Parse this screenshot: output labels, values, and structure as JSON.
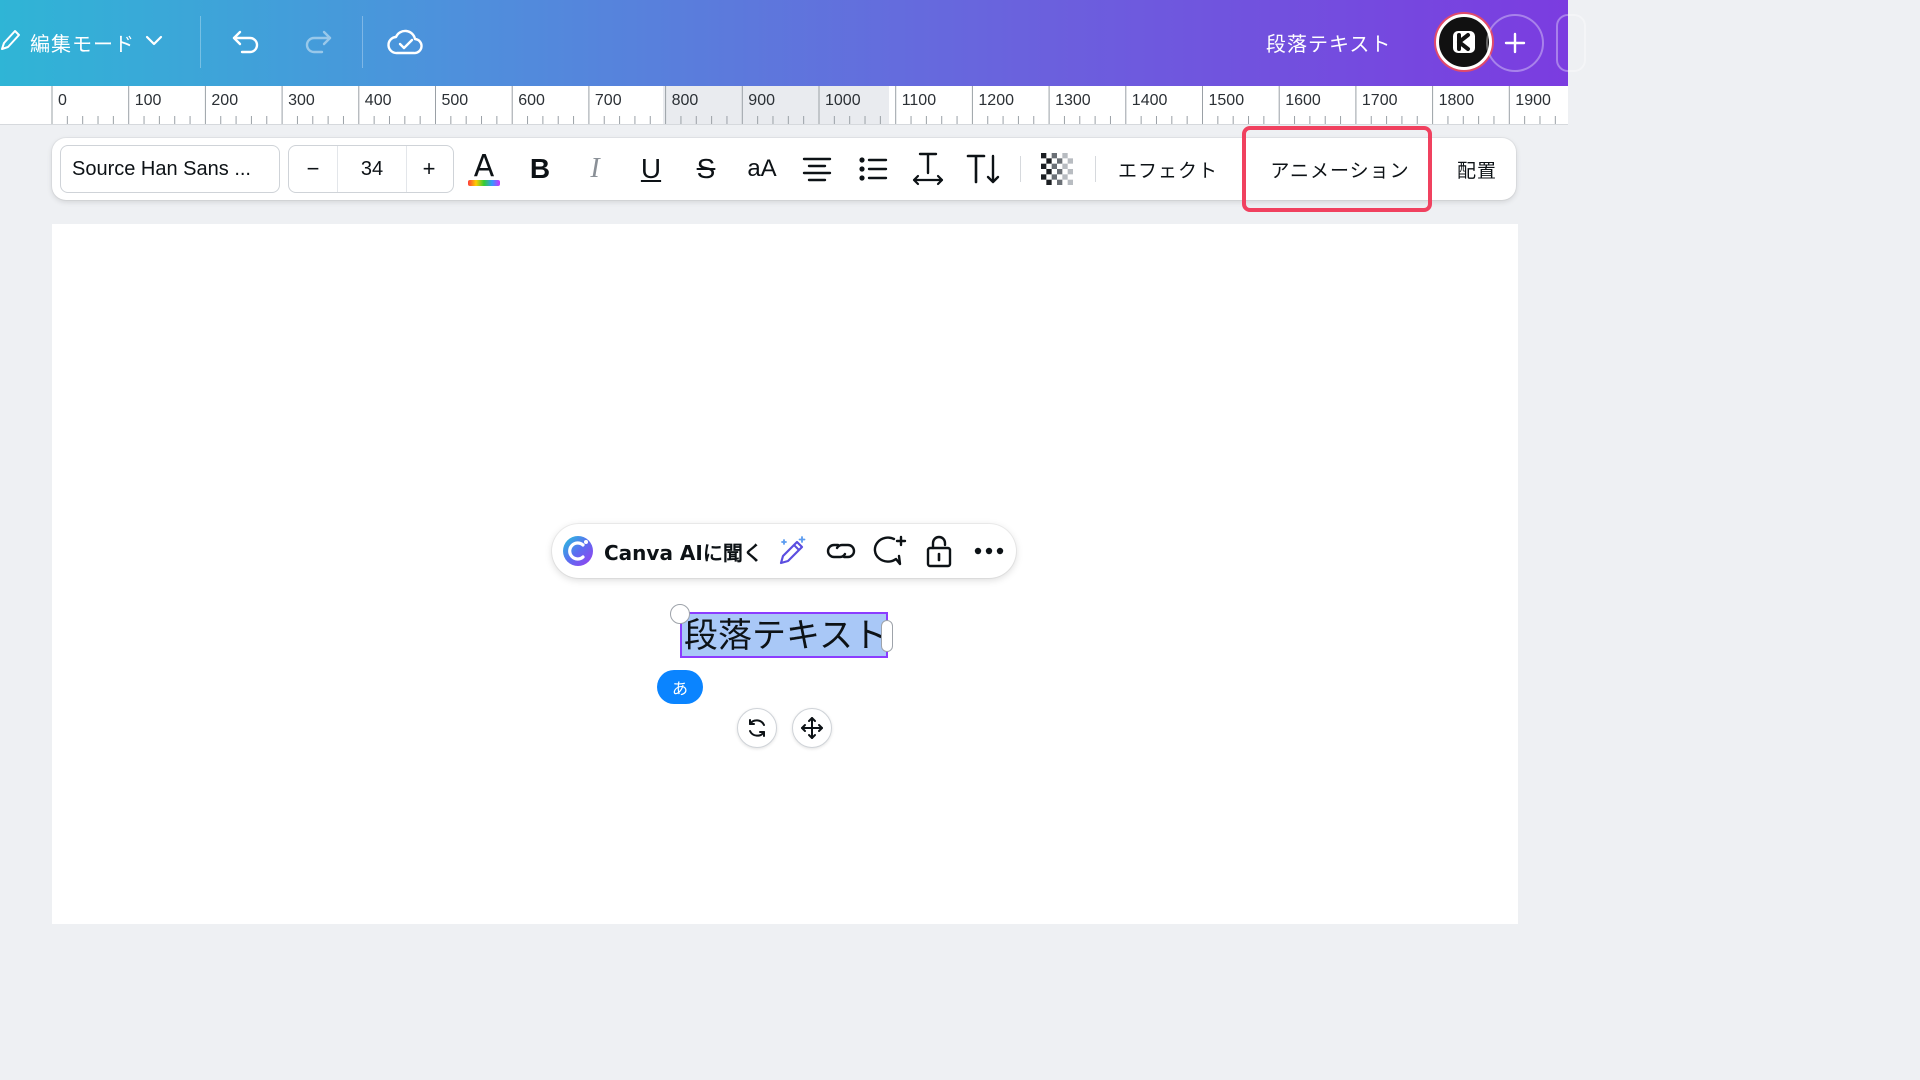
{
  "header": {
    "edit_mode_label": "編集モード",
    "doc_title": "段落テキスト"
  },
  "ruler": {
    "labels": [
      "0",
      "100",
      "200",
      "300",
      "400",
      "500",
      "600",
      "700",
      "800",
      "900",
      "1000",
      "1100",
      "1200",
      "1300",
      "1400",
      "1500",
      "1600",
      "1700",
      "1800",
      "1900"
    ],
    "highlight_range": [
      800,
      1000
    ]
  },
  "toolbar": {
    "font_name": "Source Han Sans ...",
    "font_size": "34",
    "minus_label": "−",
    "plus_label": "+",
    "text_color_glyph": "A",
    "bold_glyph": "B",
    "italic_glyph": "I",
    "underline_glyph": "U",
    "strike_glyph": "S",
    "case_glyph": "aA",
    "effects_label": "エフェクト",
    "animation_label": "アニメーション",
    "position_label": "配置"
  },
  "context_menu": {
    "ask_ai_label": "Canva AIに聞く"
  },
  "canvas": {
    "selected_text": "段落テキスト",
    "ime_badge": "あ"
  },
  "colors": {
    "accent_purple": "#8b3dff",
    "highlight_red": "#f0415f",
    "selection_blue": "#a9c8f7",
    "ime_blue": "#0a84ff"
  }
}
